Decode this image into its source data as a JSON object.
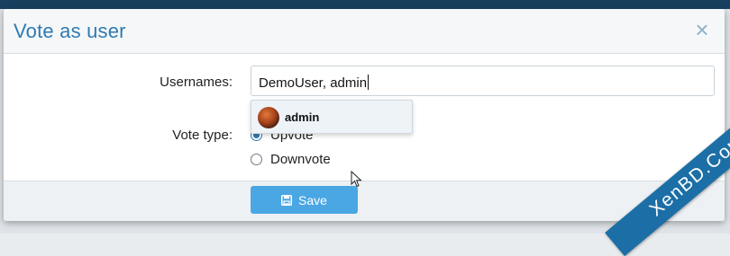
{
  "dialog": {
    "title": "Vote as user",
    "close_glyph": "×"
  },
  "form": {
    "usernames_label": "Usernames:",
    "usernames_value": "DemoUser, admin",
    "vote_type_label": "Vote type:",
    "options": [
      {
        "label": "Upvote",
        "checked": true
      },
      {
        "label": "Downvote",
        "checked": false
      }
    ]
  },
  "autocomplete": {
    "suggestion": "admin"
  },
  "footer": {
    "save_label": "Save"
  },
  "watermark": {
    "text": "XenBD.Com"
  },
  "colors": {
    "accent": "#2f7ab0",
    "button": "#4aa7e3",
    "ribbon": "#1c6fa6"
  }
}
